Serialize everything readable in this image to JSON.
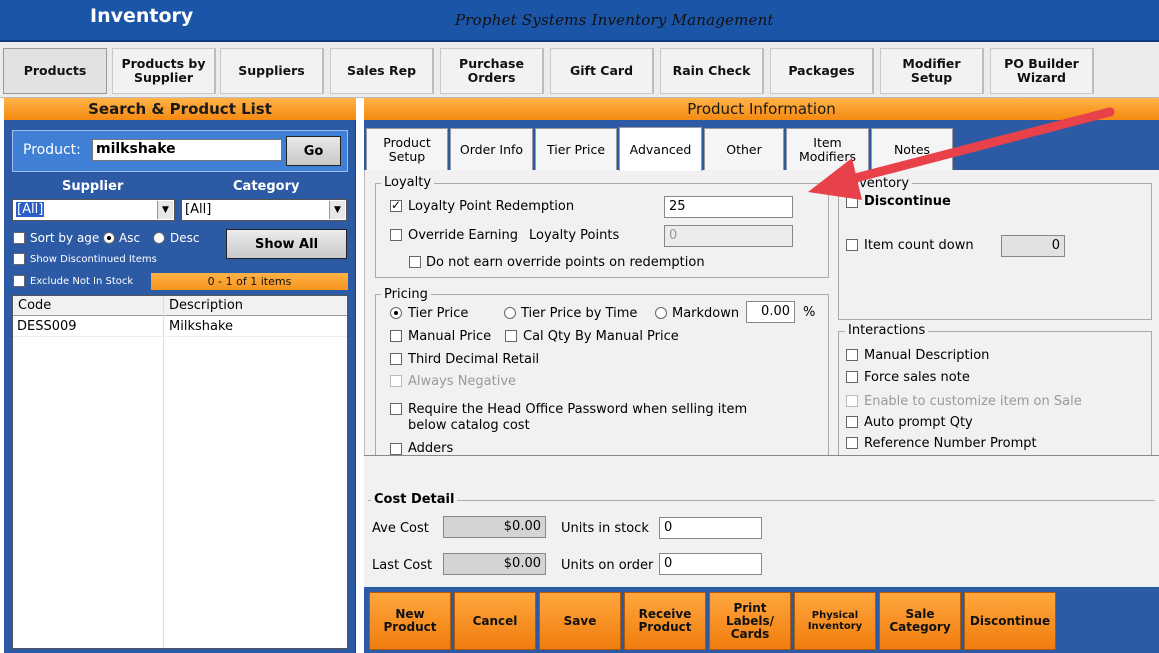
{
  "window": {
    "title": "Inventory",
    "subtitle": "Prophet Systems Inventory Management"
  },
  "nav": [
    {
      "label": "Products"
    },
    {
      "label": "Products by Supplier"
    },
    {
      "label": "Suppliers"
    },
    {
      "label": "Sales Rep"
    },
    {
      "label": "Purchase Orders"
    },
    {
      "label": "Gift Card"
    },
    {
      "label": "Rain Check"
    },
    {
      "label": "Packages"
    },
    {
      "label": "Modifier Setup"
    },
    {
      "label": "PO Builder Wizard"
    }
  ],
  "search": {
    "header": "Search & Product List",
    "product_label": "Product:",
    "product_value": "milkshake",
    "go_label": "Go",
    "supplier_label": "Supplier",
    "category_label": "Category",
    "supplier_value": "[All]",
    "category_value": "[All]",
    "sort_by_age": "Sort by age",
    "asc": "Asc",
    "desc": "Desc",
    "show_all": "Show All",
    "show_discontinued": "Show Discontinued Items",
    "exclude_not_in_stock": "Exclude Not In Stock",
    "items_count": "0 - 1 of 1 items",
    "columns": [
      "Code",
      "Description"
    ],
    "rows": [
      {
        "code": "DESS009",
        "description": "Milkshake"
      }
    ]
  },
  "product": {
    "header": "Product Information",
    "tabs": [
      {
        "label": "Product Setup"
      },
      {
        "label": "Order Info"
      },
      {
        "label": "Tier Price"
      },
      {
        "label": "Advanced"
      },
      {
        "label": "Other"
      },
      {
        "label": "Item Modifiers"
      },
      {
        "label": "Notes"
      }
    ],
    "loyalty": {
      "title": "Loyalty",
      "redemption_label": "Loyalty Point Redemption",
      "redemption_value": "25",
      "override_label": "Override Earning",
      "points_label": "Loyalty Points",
      "points_value": "0",
      "no_override_label": "Do not earn override points on redemption"
    },
    "pricing": {
      "title": "Pricing",
      "tier_price": "Tier Price",
      "tier_price_by_time": "Tier Price by Time",
      "markdown": "Markdown",
      "markdown_value": "0.00",
      "percent": "%",
      "manual_price": "Manual Price",
      "cal_qty": "Cal Qty By Manual Price",
      "third_decimal": "Third Decimal Retail",
      "always_negative": "Always Negative",
      "require_password_line1": "Require the Head Office Password when selling item",
      "require_password_line2": "below catalog cost",
      "adders": "Adders"
    },
    "inventory": {
      "title": "Inventory",
      "discontinue": "Discontinue",
      "item_count_down": "Item count down",
      "count_value": "0"
    },
    "interactions": {
      "title": "Interactions",
      "manual_description": "Manual Description",
      "force_sales_note": "Force sales note",
      "enable_customize": "Enable to customize item on Sale",
      "auto_prompt_qty": "Auto prompt Qty",
      "reference_number": "Reference Number Prompt"
    },
    "cost": {
      "title": "Cost Detail",
      "ave_cost_label": "Ave Cost",
      "ave_cost_value": "$0.00",
      "last_cost_label": "Last Cost",
      "last_cost_value": "$0.00",
      "units_in_stock_label": "Units in stock",
      "units_in_stock_value": "0",
      "units_on_order_label": "Units on order",
      "units_on_order_value": "0"
    }
  },
  "actions": [
    {
      "label": "New Product"
    },
    {
      "label": "Cancel"
    },
    {
      "label": "Save"
    },
    {
      "label": "Receive Product"
    },
    {
      "label": "Print Labels/ Cards"
    },
    {
      "label": "Physical Inventory"
    },
    {
      "label": "Sale Category"
    },
    {
      "label": "Discontinue"
    }
  ],
  "colors": {
    "title_blue": "#1a55a8",
    "panel_blue": "#2c5aa5",
    "orange": "#f58a12",
    "arrow_red": "#e8414a"
  }
}
